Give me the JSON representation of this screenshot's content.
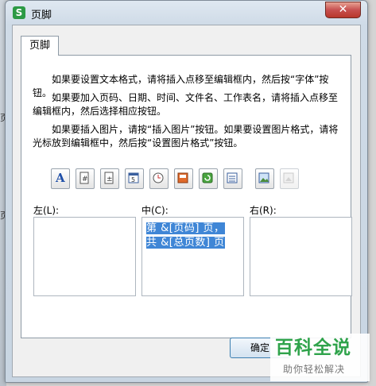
{
  "window": {
    "title": "页脚",
    "app_icon": "S",
    "close_glyph": "✕"
  },
  "tab": {
    "label": "页脚"
  },
  "instructions": [
    "如果要设置文本格式，请将插入点移至编辑框内，然后按“字体”按钮。",
    "如果要加入页码、日期、时间、文件名、工作表名，请将插入点移至编辑框内，然后选择相应按钮。",
    "如果要插入图片，请按“插入图片”按钮。如果要设置图片格式，请将光标放到编辑框中，然后按“设置图片格式”按钮。"
  ],
  "toolbar": [
    {
      "name": "font-icon",
      "glyph": "A",
      "color": "#1f4fa8"
    },
    {
      "name": "page-number-icon",
      "glyph": "#"
    },
    {
      "name": "total-pages-icon",
      "glyph": "±"
    },
    {
      "name": "date-icon",
      "glyph": "5"
    },
    {
      "name": "time-icon",
      "glyph": "◷"
    },
    {
      "name": "file-path-icon",
      "glyph": ""
    },
    {
      "name": "filename-icon",
      "glyph": ""
    },
    {
      "name": "sheet-name-icon",
      "glyph": ""
    },
    {
      "name": "insert-picture-icon",
      "glyph": ""
    },
    {
      "name": "format-picture-icon",
      "glyph": ""
    }
  ],
  "sections": {
    "left": {
      "label": "左(L):",
      "content": ""
    },
    "center": {
      "label": "中(C):",
      "line1": "第 &[页码] 页，",
      "line2": "共 &[总页数] 页"
    },
    "right": {
      "label": "右(R):",
      "content": ""
    }
  },
  "buttons": {
    "ok": "确定"
  },
  "watermark": {
    "title": "百科全说",
    "subtitle": "助你轻松解决"
  },
  "background": {
    "left_mark_1": "页",
    "left_mark_2": "页"
  },
  "colors": {
    "selection": "#3f86d6",
    "watermark_green": "#2fa34b",
    "close_red": "#c75050"
  }
}
